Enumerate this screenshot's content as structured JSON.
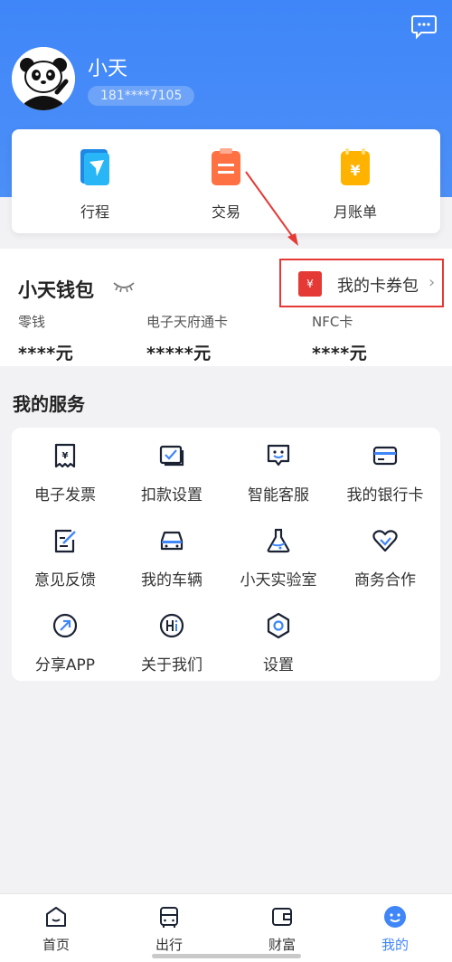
{
  "profile": {
    "name": "小天",
    "phone": "181****7105"
  },
  "quick_actions": [
    {
      "label": "行程",
      "icon": "itinerary-icon"
    },
    {
      "label": "交易",
      "icon": "transaction-icon"
    },
    {
      "label": "月账单",
      "icon": "monthly-bill-icon"
    }
  ],
  "wallet": {
    "title": "小天钱包",
    "coupon_label": "我的卡券包",
    "coupon_icon_glyph": "¥",
    "columns": [
      {
        "label": "零钱",
        "value": "****元"
      },
      {
        "label": "电子天府通卡",
        "value": "*****元"
      },
      {
        "label": "NFC卡",
        "value": "****元"
      }
    ]
  },
  "services": {
    "title": "我的服务",
    "items": [
      {
        "label": "电子发票",
        "icon": "e-invoice-icon"
      },
      {
        "label": "扣款设置",
        "icon": "deduction-settings-icon"
      },
      {
        "label": "智能客服",
        "icon": "customer-service-icon"
      },
      {
        "label": "我的银行卡",
        "icon": "bank-card-icon"
      },
      {
        "label": "意见反馈",
        "icon": "feedback-icon"
      },
      {
        "label": "我的车辆",
        "icon": "vehicle-icon"
      },
      {
        "label": "小天实验室",
        "icon": "lab-icon"
      },
      {
        "label": "商务合作",
        "icon": "cooperation-icon"
      },
      {
        "label": "分享APP",
        "icon": "share-icon"
      },
      {
        "label": "关于我们",
        "icon": "about-icon"
      },
      {
        "label": "设置",
        "icon": "settings-icon"
      }
    ]
  },
  "tabbar": {
    "tabs": [
      {
        "label": "首页",
        "icon": "home-icon"
      },
      {
        "label": "出行",
        "icon": "bus-icon"
      },
      {
        "label": "财富",
        "icon": "wallet-icon"
      },
      {
        "label": "我的",
        "icon": "profile-smile-icon",
        "active": true
      }
    ]
  },
  "colors": {
    "accent": "#3f86f8",
    "highlight": "#e53935"
  }
}
